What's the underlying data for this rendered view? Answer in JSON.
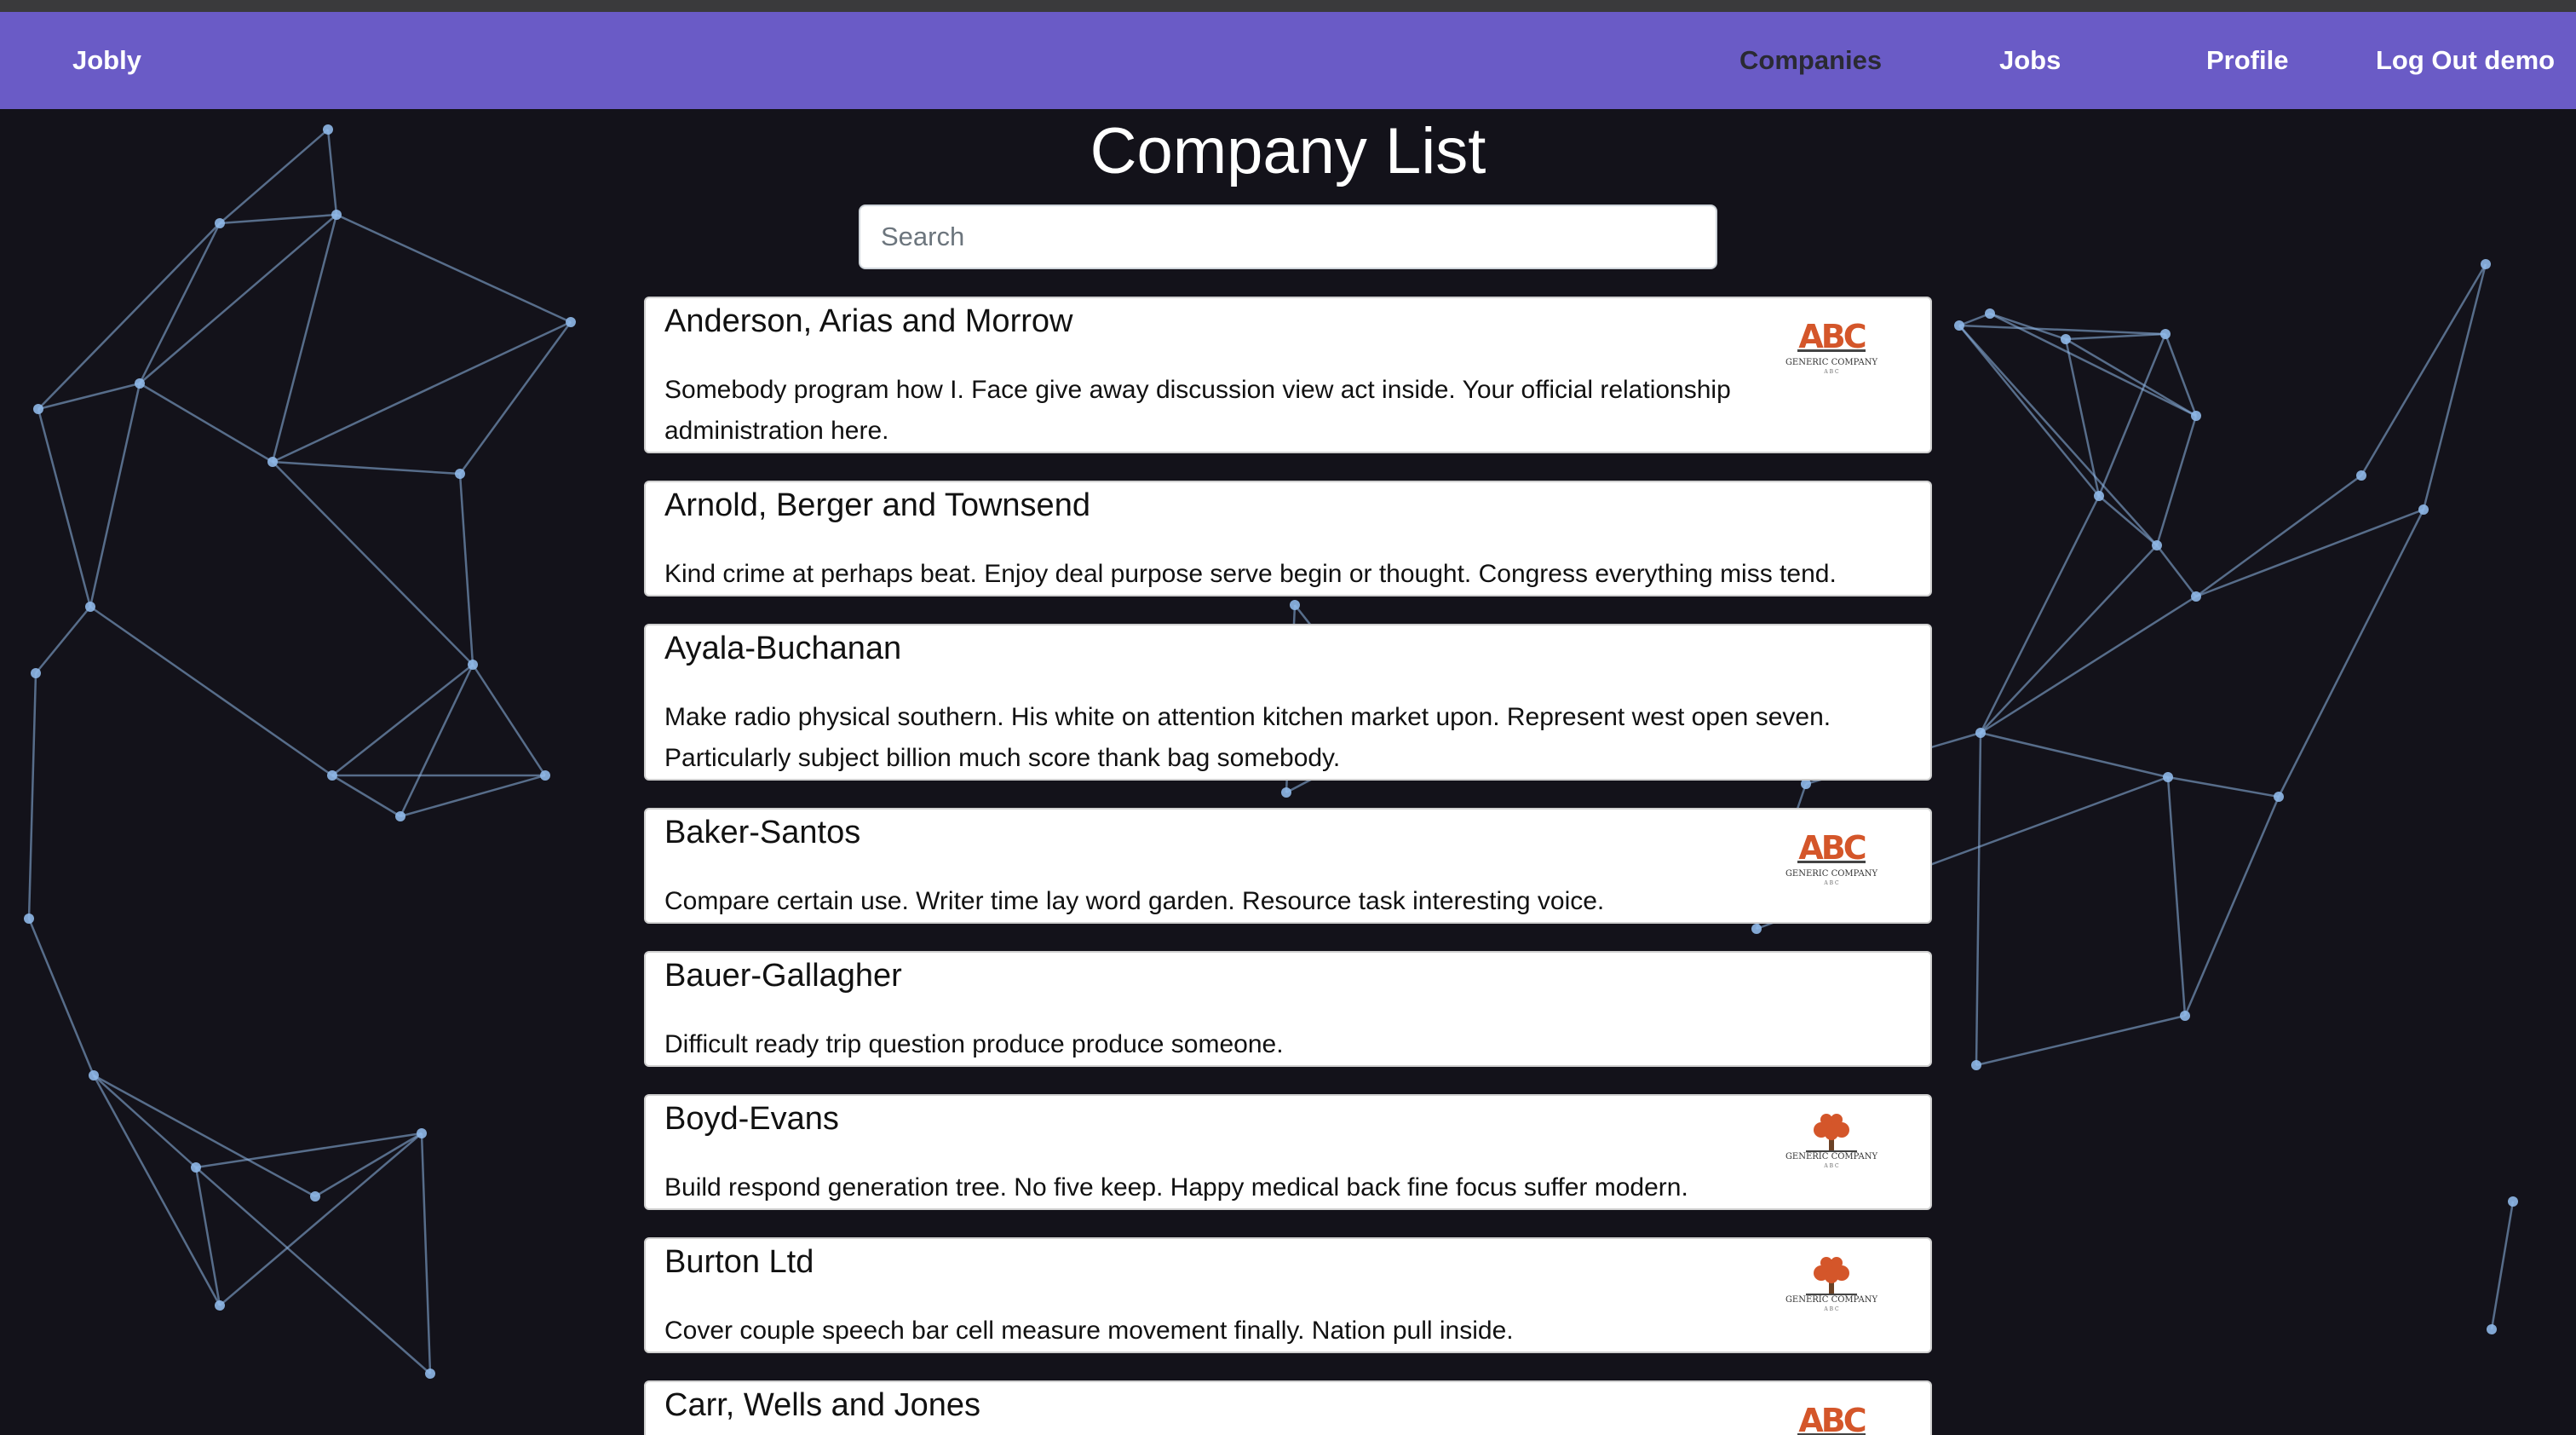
{
  "navbar": {
    "brand": "Jobly",
    "links": [
      "Companies",
      "Jobs",
      "Profile",
      "Log Out demo"
    ]
  },
  "page": {
    "title": "Company List",
    "search_placeholder": "Search"
  },
  "companies": [
    {
      "name": "Anderson, Arias and Morrow",
      "description": "Somebody program how I. Face give away discussion view act inside. Your official relationship administration here.",
      "logo": "abc-logo"
    },
    {
      "name": "Arnold, Berger and Townsend",
      "description": "Kind crime at perhaps beat. Enjoy deal purpose serve begin or thought. Congress everything miss tend.",
      "logo": ""
    },
    {
      "name": "Ayala-Buchanan",
      "description": "Make radio physical southern. His white on attention kitchen market upon. Represent west open seven. Particularly subject billion much score thank bag somebody.",
      "logo": ""
    },
    {
      "name": "Baker-Santos",
      "description": "Compare certain use. Writer time lay word garden. Resource task interesting voice.",
      "logo": "abc-logo"
    },
    {
      "name": "Bauer-Gallagher",
      "description": "Difficult ready trip question produce produce someone.",
      "logo": ""
    },
    {
      "name": "Boyd-Evans",
      "description": "Build respond generation tree. No five keep. Happy medical back fine focus suffer modern.",
      "logo": "tree-logo"
    },
    {
      "name": "Burton Ltd",
      "description": "Cover couple speech bar cell measure movement finally. Nation pull inside.",
      "logo": "tree-logo"
    },
    {
      "name": "Carr, Wells and Jones",
      "description": "",
      "logo": "abc-logo"
    }
  ],
  "logo_text": {
    "abc_letters": "ABC",
    "generic_company": "GENERIC COMPANY",
    "abc_small": "A B C"
  },
  "colors": {
    "navbar": "#6a5bc6",
    "background": "#13121a",
    "network_line": "#8fb8e8",
    "logo_orange": "#d4562a"
  }
}
